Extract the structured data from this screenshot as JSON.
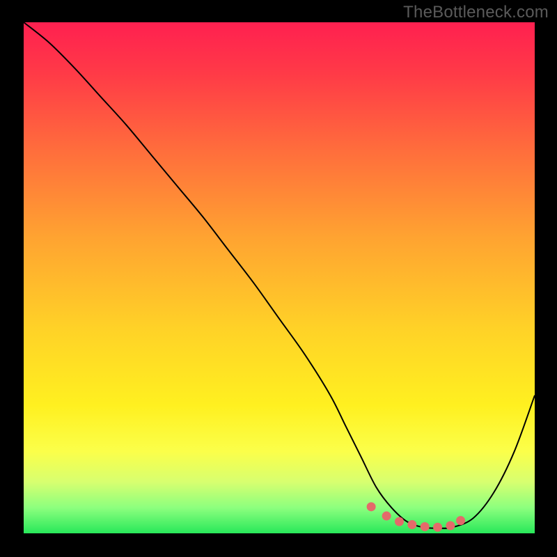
{
  "watermark": "TheBottleneck.com",
  "colors": {
    "background": "#000000",
    "gradient_top": "#ff2050",
    "gradient_mid": "#fff020",
    "gradient_bottom": "#28e85a",
    "curve": "#000000",
    "marker": "#e46a6a"
  },
  "chart_data": {
    "type": "line",
    "title": "",
    "xlabel": "",
    "ylabel": "",
    "xlim": [
      0,
      100
    ],
    "ylim": [
      0,
      100
    ],
    "series": [
      {
        "name": "bottleneck-curve",
        "x": [
          0,
          5,
          10,
          15,
          20,
          25,
          30,
          35,
          40,
          45,
          50,
          55,
          60,
          63,
          66,
          69,
          72,
          75,
          78,
          81,
          84,
          88,
          92,
          96,
          100
        ],
        "y": [
          100,
          96,
          91,
          85.5,
          80,
          74,
          68,
          62,
          55.5,
          49,
          42,
          35,
          27,
          21,
          15,
          9,
          5,
          2.3,
          1.2,
          1.0,
          1.2,
          3,
          8,
          16,
          27
        ]
      }
    ],
    "markers": {
      "name": "optimal-region",
      "x": [
        68,
        71,
        73.5,
        76,
        78.5,
        81,
        83.5,
        85.5
      ],
      "y": [
        5.2,
        3.4,
        2.3,
        1.7,
        1.3,
        1.2,
        1.5,
        2.5
      ]
    }
  }
}
